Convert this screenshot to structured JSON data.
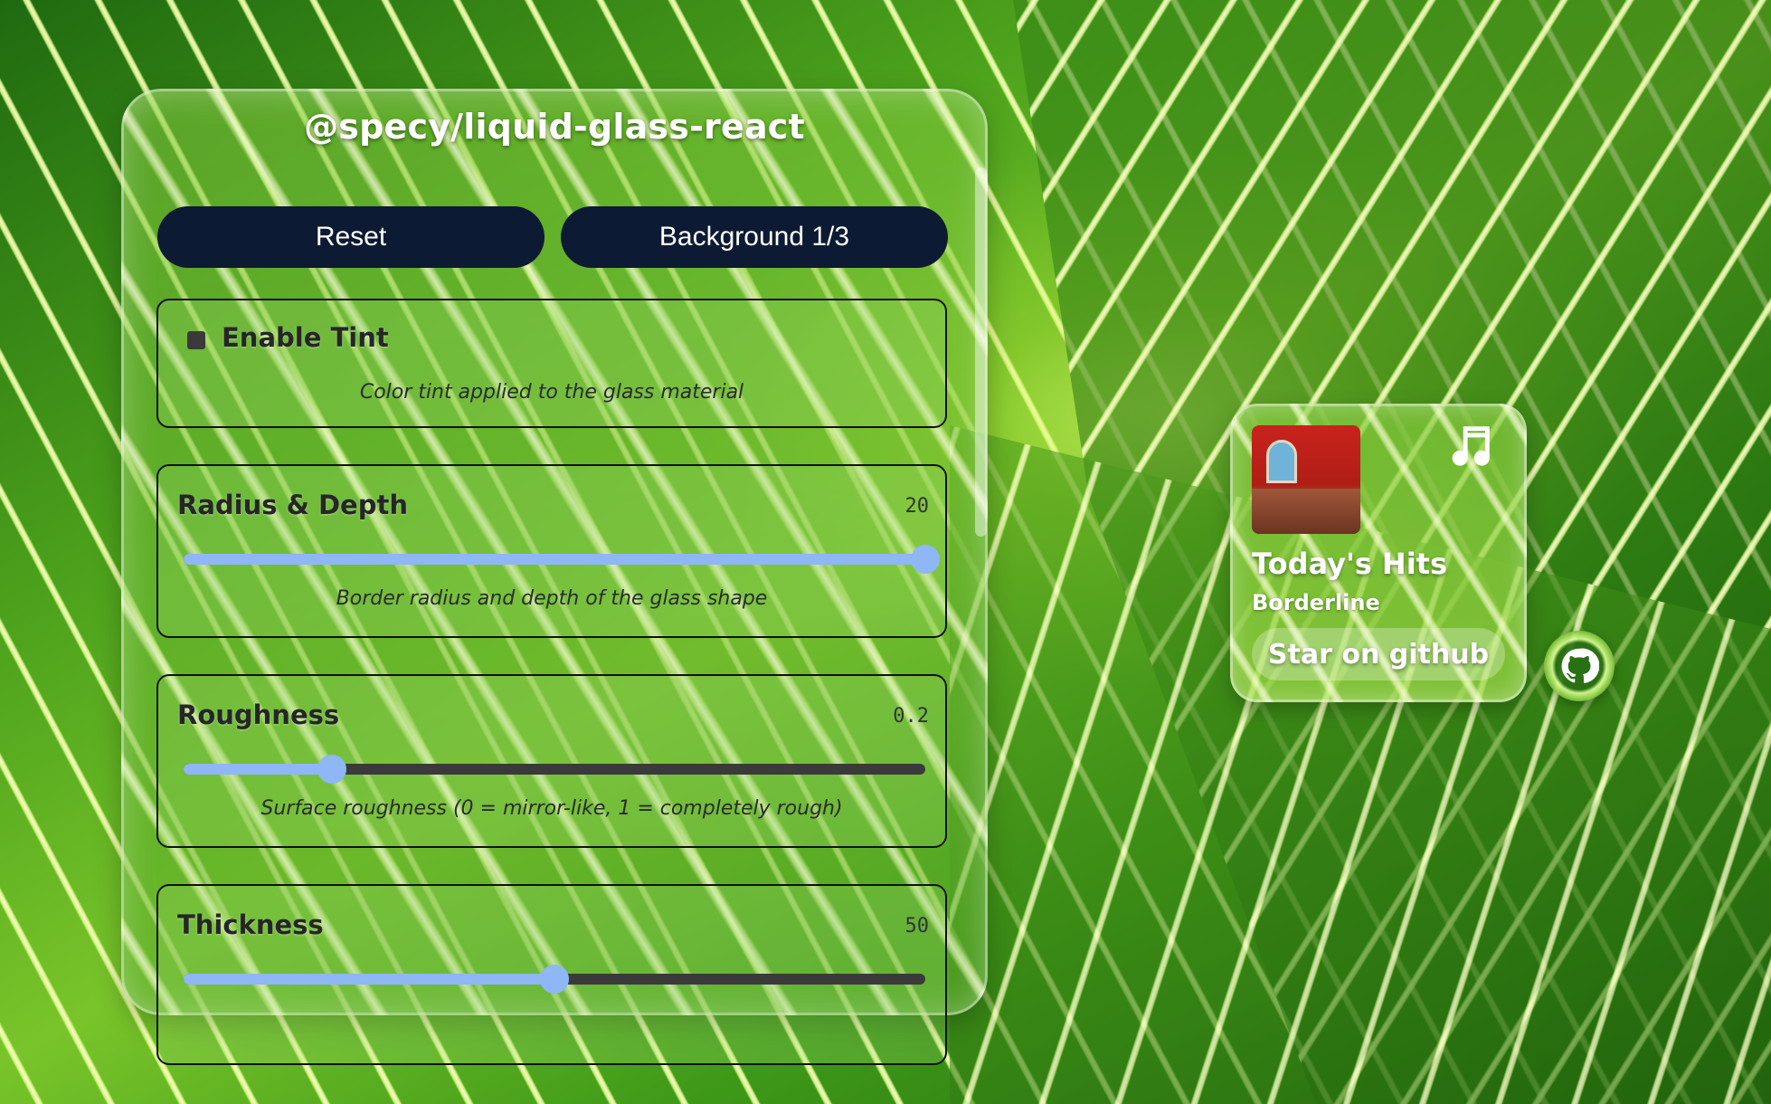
{
  "panel": {
    "title": "@specy/liquid-glass-react",
    "reset_label": "Reset",
    "background_label": "Background 1/3"
  },
  "controls": {
    "tint": {
      "label": "Enable Tint",
      "checked": false,
      "description": "Color tint applied to the glass material"
    },
    "radius": {
      "label": "Radius & Depth",
      "value": "20",
      "level": 1.0,
      "description": "Border radius and depth of the glass shape"
    },
    "roughness": {
      "label": "Roughness",
      "value": "0.2",
      "level": 0.2,
      "description": "Surface roughness (0 = mirror-like, 1 = completely rough)"
    },
    "thickness": {
      "label": "Thickness",
      "value": "50",
      "level": 0.5
    }
  },
  "music": {
    "title": "Today's Hits",
    "artist": "Borderline",
    "star_label": "Star on github",
    "icon": "music-note-icon"
  },
  "github": {
    "icon": "github-icon"
  },
  "colors": {
    "button_bg": "#0c1a33",
    "slider_fill": "#8fb6f5",
    "slider_track": "#3a3a3a"
  }
}
